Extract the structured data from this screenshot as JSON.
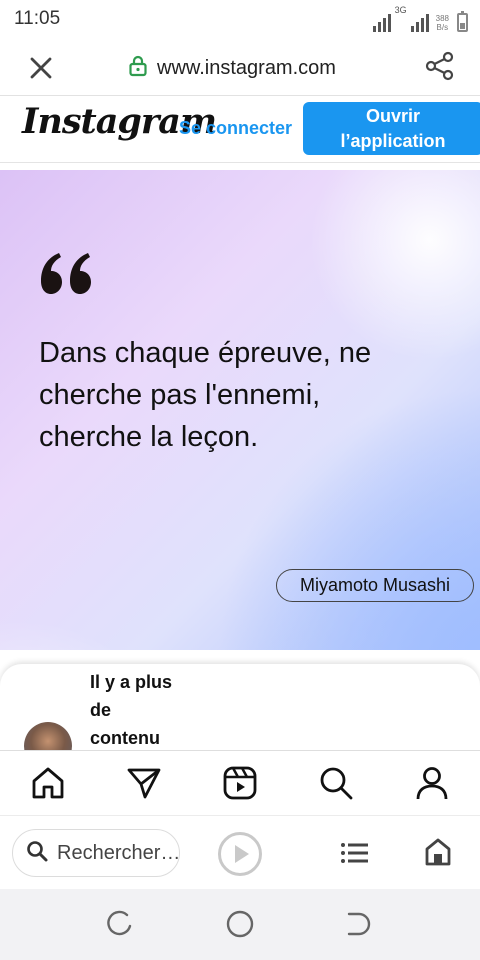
{
  "status_bar": {
    "time": "11:05",
    "network_type": "3G",
    "speed_value": "388",
    "speed_unit": "B/s"
  },
  "browser": {
    "url": "www.instagram.com",
    "close_icon": "close-icon",
    "lock_icon": "lock-icon",
    "share_icon": "share-icon"
  },
  "instagram_header": {
    "logo": "Instagram",
    "login_label": "Se connecter",
    "open_app_line1": "Ouvrir",
    "open_app_line2": "l’application"
  },
  "post": {
    "quote_lines": [
      "Dans chaque épreuve, ne",
      "cherche pas l'ennemi,",
      "cherche la leçon."
    ],
    "author": "Miyamoto Musashi"
  },
  "more_content": {
    "lines": [
      "Il y a plus",
      "de",
      "contenu"
    ]
  },
  "ig_nav": {
    "items": [
      "home-icon",
      "direct-message-icon",
      "reels-icon",
      "search-icon",
      "profile-icon"
    ]
  },
  "browser_bottom": {
    "search_placeholder": "Rechercher…",
    "icons": [
      "search-icon",
      "play-icon",
      "tabs-list-icon",
      "home-icon"
    ]
  },
  "system_nav": {
    "icons": [
      "recent-apps-icon",
      "home-icon",
      "back-icon"
    ]
  },
  "colors": {
    "accent_blue": "#1a96f0",
    "status_green": "#2e9b4e"
  }
}
